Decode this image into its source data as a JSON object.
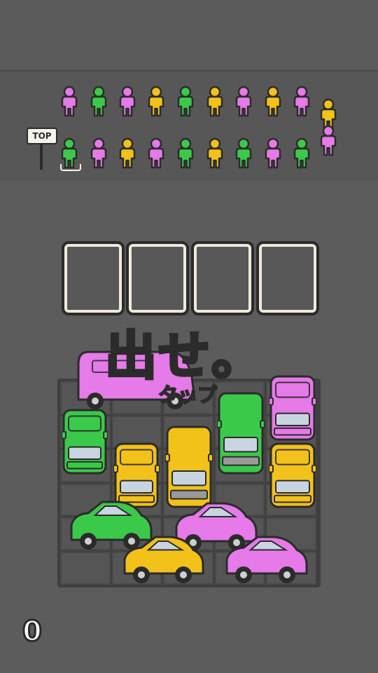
{
  "colors": {
    "pink": "#e57ae8",
    "green": "#3bc94a",
    "yellow": "#f2c21b",
    "outline": "#2b2b2b",
    "window": "#c8d4e0"
  },
  "queue": {
    "sign_label": "TOP",
    "row_top": [
      "pink",
      "green",
      "pink",
      "yellow",
      "green",
      "yellow",
      "pink",
      "yellow",
      "pink",
      "yellow"
    ],
    "row_bottom": [
      "green",
      "pink",
      "yellow",
      "pink",
      "green",
      "yellow",
      "green",
      "pink",
      "green",
      "pink"
    ]
  },
  "slots": {
    "count": 4
  },
  "tutorial": {
    "headline": "出せ。",
    "hint": "タップ"
  },
  "score": {
    "value": "0"
  },
  "cars": [
    {
      "color": "pink",
      "type": "van-h"
    },
    {
      "color": "green",
      "type": "car-v"
    },
    {
      "color": "yellow",
      "type": "car-v"
    },
    {
      "color": "yellow",
      "type": "van-v"
    },
    {
      "color": "green",
      "type": "van-v"
    },
    {
      "color": "pink",
      "type": "car-v"
    },
    {
      "color": "yellow",
      "type": "car-v"
    },
    {
      "color": "green",
      "type": "car-h"
    },
    {
      "color": "pink",
      "type": "car-h"
    },
    {
      "color": "yellow",
      "type": "car-h"
    },
    {
      "color": "pink",
      "type": "car-h"
    }
  ]
}
